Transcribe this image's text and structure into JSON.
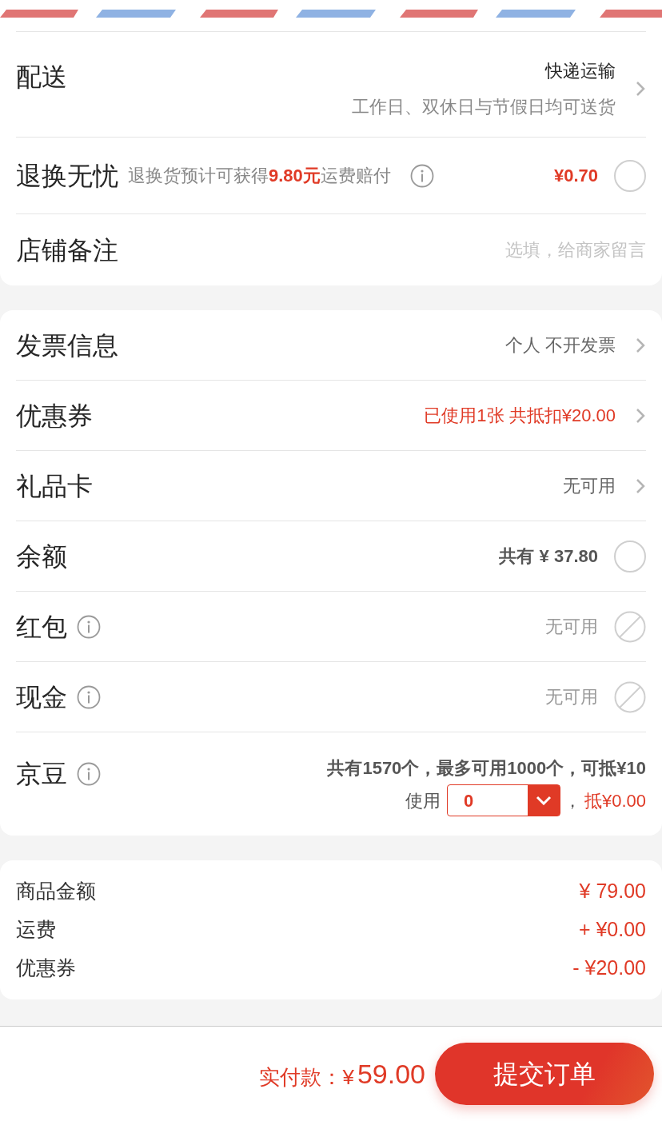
{
  "delivery": {
    "label": "配送",
    "value": "快递运输",
    "note": "工作日、双休日与节假日均可送货"
  },
  "return_service": {
    "label": "退换无忧",
    "description": "退换货预计可获得**9.80元**运费赔付",
    "price": "¥0.70",
    "checked": false
  },
  "shop_note": {
    "label": "店铺备注",
    "placeholder": "选填，给商家留言"
  },
  "payment_rows": [
    {
      "kind": "link",
      "label": "发票信息",
      "value": "个人 不开发票",
      "emphasis": false
    },
    {
      "kind": "link",
      "label": "优惠券",
      "value": "已使用1张 共抵扣¥20.00",
      "emphasis": true
    },
    {
      "kind": "link",
      "label": "礼品卡",
      "value": "无可用",
      "emphasis": false
    },
    {
      "kind": "radio",
      "label": "余额",
      "value": "共有 ¥ 37.80",
      "checked": false
    },
    {
      "kind": "disabled",
      "label": "红包",
      "value": "无可用"
    },
    {
      "kind": "disabled",
      "label": "现金",
      "value": "无可用"
    },
    {
      "kind": "beans",
      "label": "京豆",
      "value": "共有1570个，最多可用1000个，可抵¥10",
      "use_label": "使用",
      "amount": "0",
      "separator": "，",
      "discount": "抵¥0.00"
    }
  ],
  "summary": [
    {
      "label": "商品金额",
      "amount": "¥ 79.00"
    },
    {
      "label": "运费",
      "amount": "+ ¥0.00"
    },
    {
      "label": "优惠券",
      "amount": "- ¥20.00"
    }
  ],
  "footer": {
    "total_label": "实付款：",
    "currency": "¥",
    "total": "59.00",
    "submit": "提交订单"
  }
}
